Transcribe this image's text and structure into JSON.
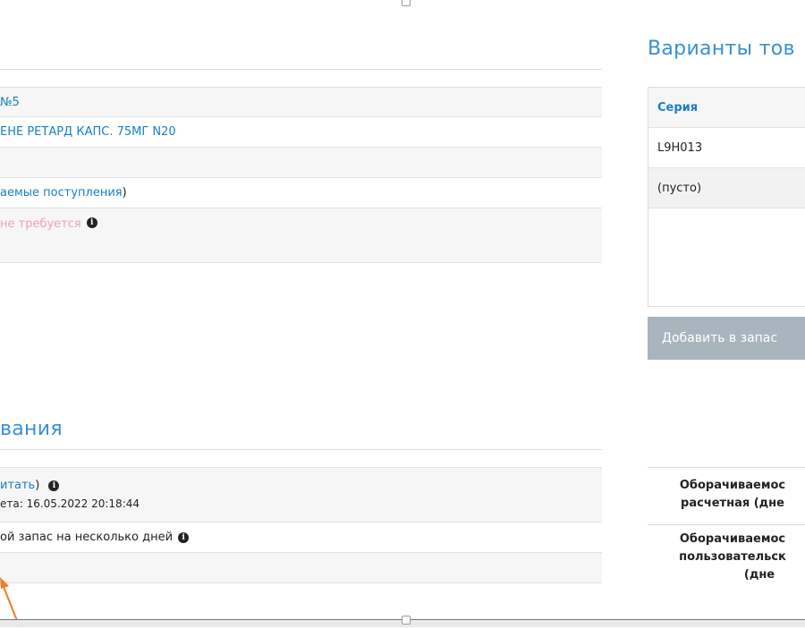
{
  "main_section": {
    "rows": [
      {
        "text": "№5"
      },
      {
        "text": "ЕНЕ РЕТАРД КАПС. 75МГ N20"
      },
      {
        "text": ""
      },
      {
        "link": "аемые поступления",
        "suffix": ")"
      },
      {
        "status": "не требуется"
      }
    ]
  },
  "variants": {
    "title": "Варианты тов",
    "column_header": "Серия",
    "items": [
      "L9H013",
      "(пусто)"
    ],
    "add_button": "Добавить в запас"
  },
  "forecast_section": {
    "title": "вания",
    "recalc_link": "итать",
    "recalc_suffix": ")",
    "calc_date": "ета: 16.05.2022 20:18:44",
    "stock_label": "ой запас на несколько дней"
  },
  "turnover": {
    "calculated_line1": "Оборачиваемос",
    "calculated_line2": "расчетная (дне",
    "custom_line1": "Оборачиваемос",
    "custom_line2": "пользовательск",
    "custom_line3": "(дне"
  },
  "colors": {
    "accent": "#3a8fd3",
    "link": "#1a7fc4",
    "status_pink": "#f0a0b4",
    "button_bg": "#a8b5bd",
    "annotation_arrow": "#f07a2a"
  },
  "icons": {
    "info": "info-circle-icon",
    "annotation": "arrow-annotation-icon"
  }
}
